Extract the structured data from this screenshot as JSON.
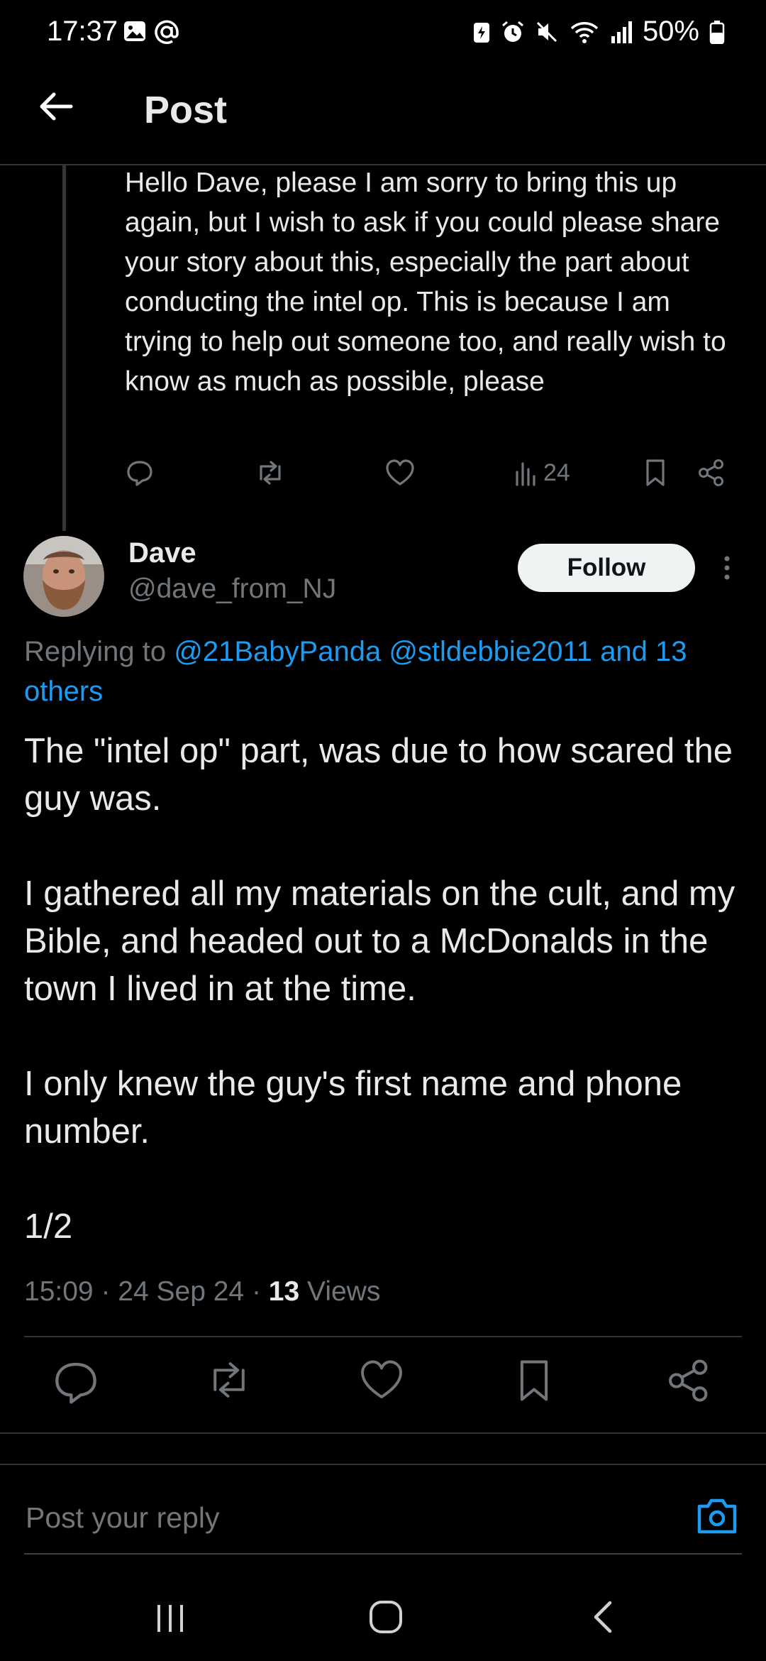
{
  "status_bar": {
    "time": "17:37",
    "battery": "50%",
    "left_icons": [
      "gallery-icon",
      "at-icon"
    ],
    "right_icons": [
      "battery-saver-icon",
      "alarm-icon",
      "mute-icon",
      "wifi-icon",
      "signal-icon",
      "battery-icon"
    ]
  },
  "header": {
    "title": "Post"
  },
  "parent_reply": {
    "text": "Hello Dave, please I am sorry to bring this up again, but I wish to ask if you could please share your story about this, especially the part about conducting the intel op. This is because I am trying to help out someone too, and really wish to know as much as possible, please",
    "views": "24"
  },
  "tweet": {
    "author_name": "Dave",
    "author_handle": "@dave_from_NJ",
    "follow_label": "Follow",
    "replying_prefix": "Replying to",
    "mention_1": "@21BabyPanda",
    "mention_2": "@stldebbie2011",
    "mention_rest": "and 13 others",
    "paragraphs": [
      "The \"intel op\" part, was due to how scared the guy was.",
      "I gathered all my materials on the cult, and my Bible, and headed out to a McDonalds in the town I lived in at the time.",
      "I only knew the guy's first name and phone number.",
      "1/2"
    ],
    "time": "15:09",
    "date": "24 Sep 24",
    "views_count": "13",
    "views_label": "Views"
  },
  "reply_box": {
    "placeholder": "Post your reply"
  },
  "colors": {
    "accent": "#1d9bf0",
    "muted": "#71767b",
    "text": "#e7e9ea",
    "background": "#000000"
  }
}
